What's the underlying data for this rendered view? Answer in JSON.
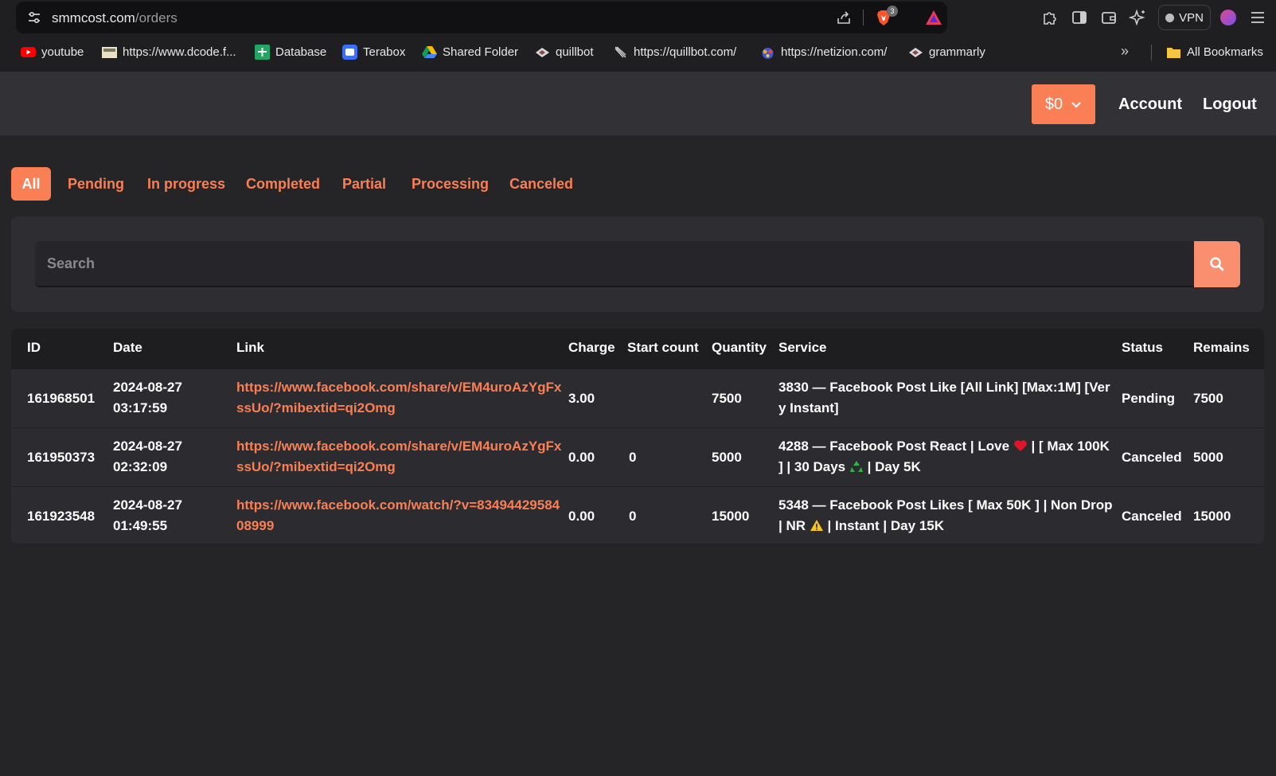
{
  "browser": {
    "url_host": "smmcost.com",
    "url_path": "/orders",
    "brave_badge": "3",
    "vpn_label": "VPN",
    "bookmarks": [
      {
        "label": "youtube",
        "icon": "youtube-icon"
      },
      {
        "label": "https://www.dcode.f...",
        "icon": "dcode-icon"
      },
      {
        "label": "Database",
        "icon": "sheets-icon"
      },
      {
        "label": "Terabox",
        "icon": "terabox-icon"
      },
      {
        "label": "Shared Folder",
        "icon": "drive-icon"
      },
      {
        "label": "quillbot",
        "icon": "quillbot-icon"
      },
      {
        "label": "https://quillbot.com/",
        "icon": "quill-icon"
      },
      {
        "label": "https://netizion.com/",
        "icon": "netizion-icon"
      },
      {
        "label": "grammarly",
        "icon": "grammarly-icon"
      }
    ],
    "all_bookmarks": "All Bookmarks"
  },
  "header": {
    "balance": "$0",
    "account": "Account",
    "logout": "Logout"
  },
  "filters": [
    "All",
    "Pending",
    "In progress",
    "Completed",
    "Partial",
    "Processing",
    "Canceled"
  ],
  "search": {
    "placeholder": "Search"
  },
  "table": {
    "headers": [
      "ID",
      "Date",
      "Link",
      "Charge",
      "Start count",
      "Quantity",
      "Service",
      "Status",
      "Remains"
    ],
    "rows": [
      {
        "id": "161968501",
        "date": "2024-08-27",
        "time": "03:17:59",
        "link": "https://www.facebook.com/share/v/EM4uroAzYgFxssUo/?mibextid=qi2Omg",
        "charge": "3.00",
        "start_count": "",
        "quantity": "7500",
        "service": "3830 — Facebook Post Like [All Link] [Max:1M] [Very Instant]",
        "status": "Pending",
        "remains": "7500"
      },
      {
        "id": "161950373",
        "date": "2024-08-27",
        "time": "02:32:09",
        "link": "https://www.facebook.com/share/v/EM4uroAzYgFxssUo/?mibextid=qi2Omg",
        "charge": "0.00",
        "start_count": "0",
        "quantity": "5000",
        "service_a": "4288 — Facebook Post React | Love",
        "service_b": " | [ Max 100K ] | 30 Days",
        "service_c": " | Day 5K",
        "status": "Canceled",
        "remains": "5000"
      },
      {
        "id": "161923548",
        "date": "2024-08-27",
        "time": "01:49:55",
        "link": "https://www.facebook.com/watch/?v=8349442958408999",
        "charge": "0.00",
        "start_count": "0",
        "quantity": "15000",
        "service_a": "5348 — Facebook Post Likes [ Max 50K ] | Non Drop | NR",
        "service_b": " | Instant | Day 15K",
        "status": "Canceled",
        "remains": "15000"
      }
    ]
  },
  "colors": {
    "accent": "#fa7f54",
    "background": "#252528",
    "header": "#323236"
  }
}
